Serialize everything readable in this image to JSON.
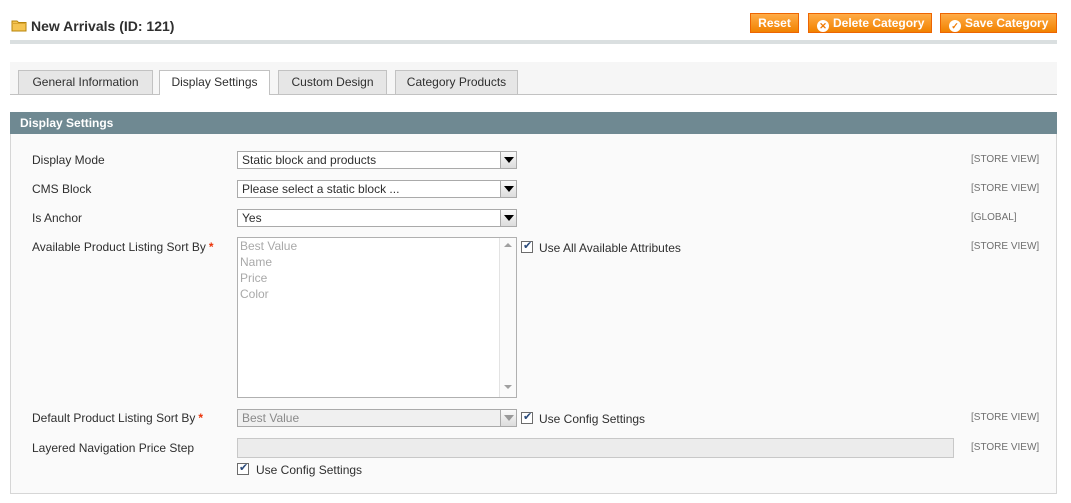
{
  "header": {
    "title": "New Arrivals (ID: 121)",
    "icon": "folder-icon",
    "buttons": {
      "reset": "Reset",
      "delete": "Delete Category",
      "save": "Save Category"
    },
    "accent_color": "#f18200"
  },
  "tabs": [
    {
      "label": "General Information",
      "active": false
    },
    {
      "label": "Display Settings",
      "active": true
    },
    {
      "label": "Custom Design",
      "active": false
    },
    {
      "label": "Category Products",
      "active": false
    }
  ],
  "section": {
    "title": "Display Settings",
    "header_color": "#6f8992"
  },
  "fields": {
    "display_mode": {
      "label": "Display Mode",
      "value": "Static block and products",
      "scope": "[STORE VIEW]"
    },
    "cms_block": {
      "label": "CMS Block",
      "value": "Please select a static block ...",
      "scope": "[STORE VIEW]"
    },
    "is_anchor": {
      "label": "Is Anchor",
      "value": "Yes",
      "scope": "[GLOBAL]"
    },
    "available_sort_by": {
      "label": "Available Product Listing Sort By",
      "required_mark": "*",
      "options": [
        "Best Value",
        "Name",
        "Price",
        "Color"
      ],
      "checkbox_label": "Use All Available Attributes",
      "checked": true,
      "scope": "[STORE VIEW]"
    },
    "default_sort_by": {
      "label": "Default Product Listing Sort By",
      "required_mark": "*",
      "value": "Best Value",
      "checkbox_label": "Use Config Settings",
      "checked": true,
      "scope": "[STORE VIEW]"
    },
    "price_step": {
      "label": "Layered Navigation Price Step",
      "value": "",
      "checkbox_label": "Use Config Settings",
      "checked": true,
      "scope": "[STORE VIEW]"
    }
  }
}
